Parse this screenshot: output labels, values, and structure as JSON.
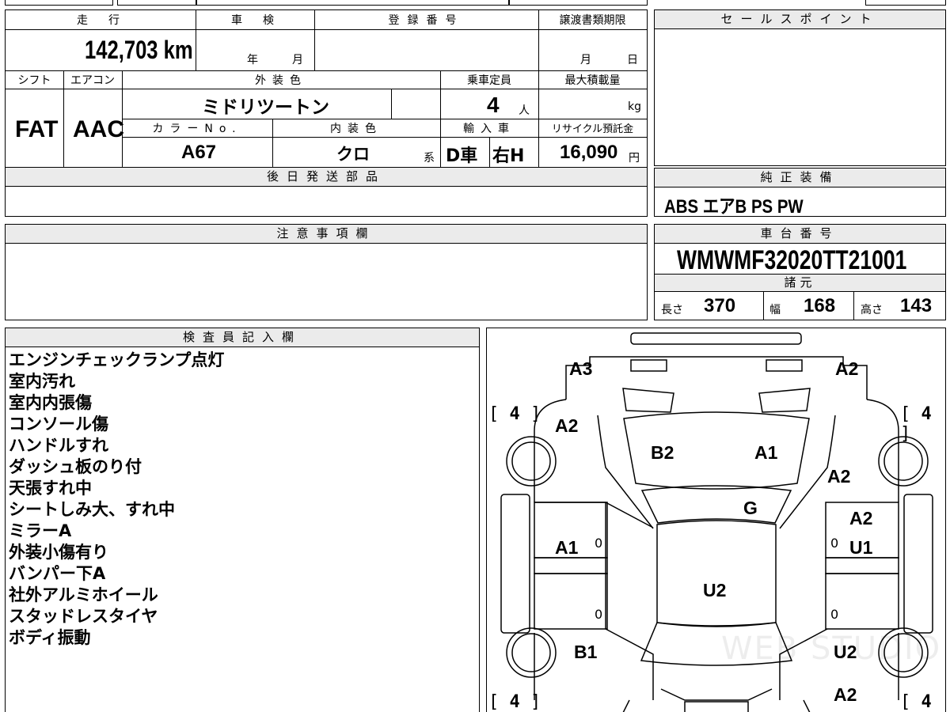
{
  "main": {
    "mileage_label": "走　行",
    "mileage_value": "142,703 km",
    "inspection_label": "車　検",
    "inspection_year": "年",
    "inspection_month": "月",
    "registration_label": "登録番号",
    "transfer_label": "譲渡書類期限",
    "transfer_month": "月",
    "transfer_day": "日",
    "shift_label": "シフト",
    "shift_value": "FAT",
    "ac_label": "エアコン",
    "ac_value": "AAC",
    "exterior_color_label": "外装色",
    "exterior_color_value": "ミドリツートン",
    "capacity_label": "乗車定員",
    "capacity_value": "4",
    "capacity_unit": "人",
    "max_load_label": "最大積載量",
    "max_load_unit": "kg",
    "color_no_label": "カラーNo.",
    "color_no_value": "A67",
    "interior_color_label": "内装色",
    "interior_color_value": "クロ",
    "interior_color_suffix": "系",
    "import_label": "輸入車",
    "import_value": "D車",
    "handle_value": "右H",
    "recycle_label": "リサイクル預託金",
    "recycle_value": "16,090",
    "recycle_unit": "円",
    "later_parts_label": "後日発送部品"
  },
  "sales": {
    "label": "セールスポイント"
  },
  "equipment": {
    "label": "純正装備",
    "value": "ABS エアB PS PW"
  },
  "caution": {
    "label": "注意事項欄"
  },
  "chassis": {
    "label": "車台番号",
    "value": "WMWMF32020TT21001",
    "specs_label": "諸元",
    "length_label": "長さ",
    "length_value": "370",
    "width_label": "幅",
    "width_value": "168",
    "height_label": "高さ",
    "height_value": "143"
  },
  "inspector": {
    "label": "検査員記入欄",
    "notes": [
      "エンジンチェックランプ点灯",
      "室内汚れ",
      "室内内張傷",
      "コンソール傷",
      "ハンドルすれ",
      "ダッシュ板のり付",
      "天張すれ中",
      "シートしみ大、すれ中",
      "ミラーA",
      "外装小傷有り",
      "バンパー下A",
      "社外アルミホイール",
      "スタッドレスタイヤ",
      "ボディ振動"
    ]
  },
  "diagram": {
    "labels": {
      "front_left": "A3",
      "front_right": "A2",
      "left_fender": "A2",
      "right_fender": "A2",
      "hood_left": "B2",
      "hood_right": "A1",
      "windshield": "G",
      "right_front_door": "A2",
      "left_door": "A1",
      "right_rear_door": "U1",
      "roof": "U2",
      "rear_left": "B1",
      "rear_right": "U2",
      "rear_bottom_right": "A2"
    },
    "tire_tl": "4",
    "tire_tr": "4",
    "tire_bl": "4",
    "tire_br": "4",
    "zero_mark": "0",
    "watermark": "WEB STUDIO"
  }
}
